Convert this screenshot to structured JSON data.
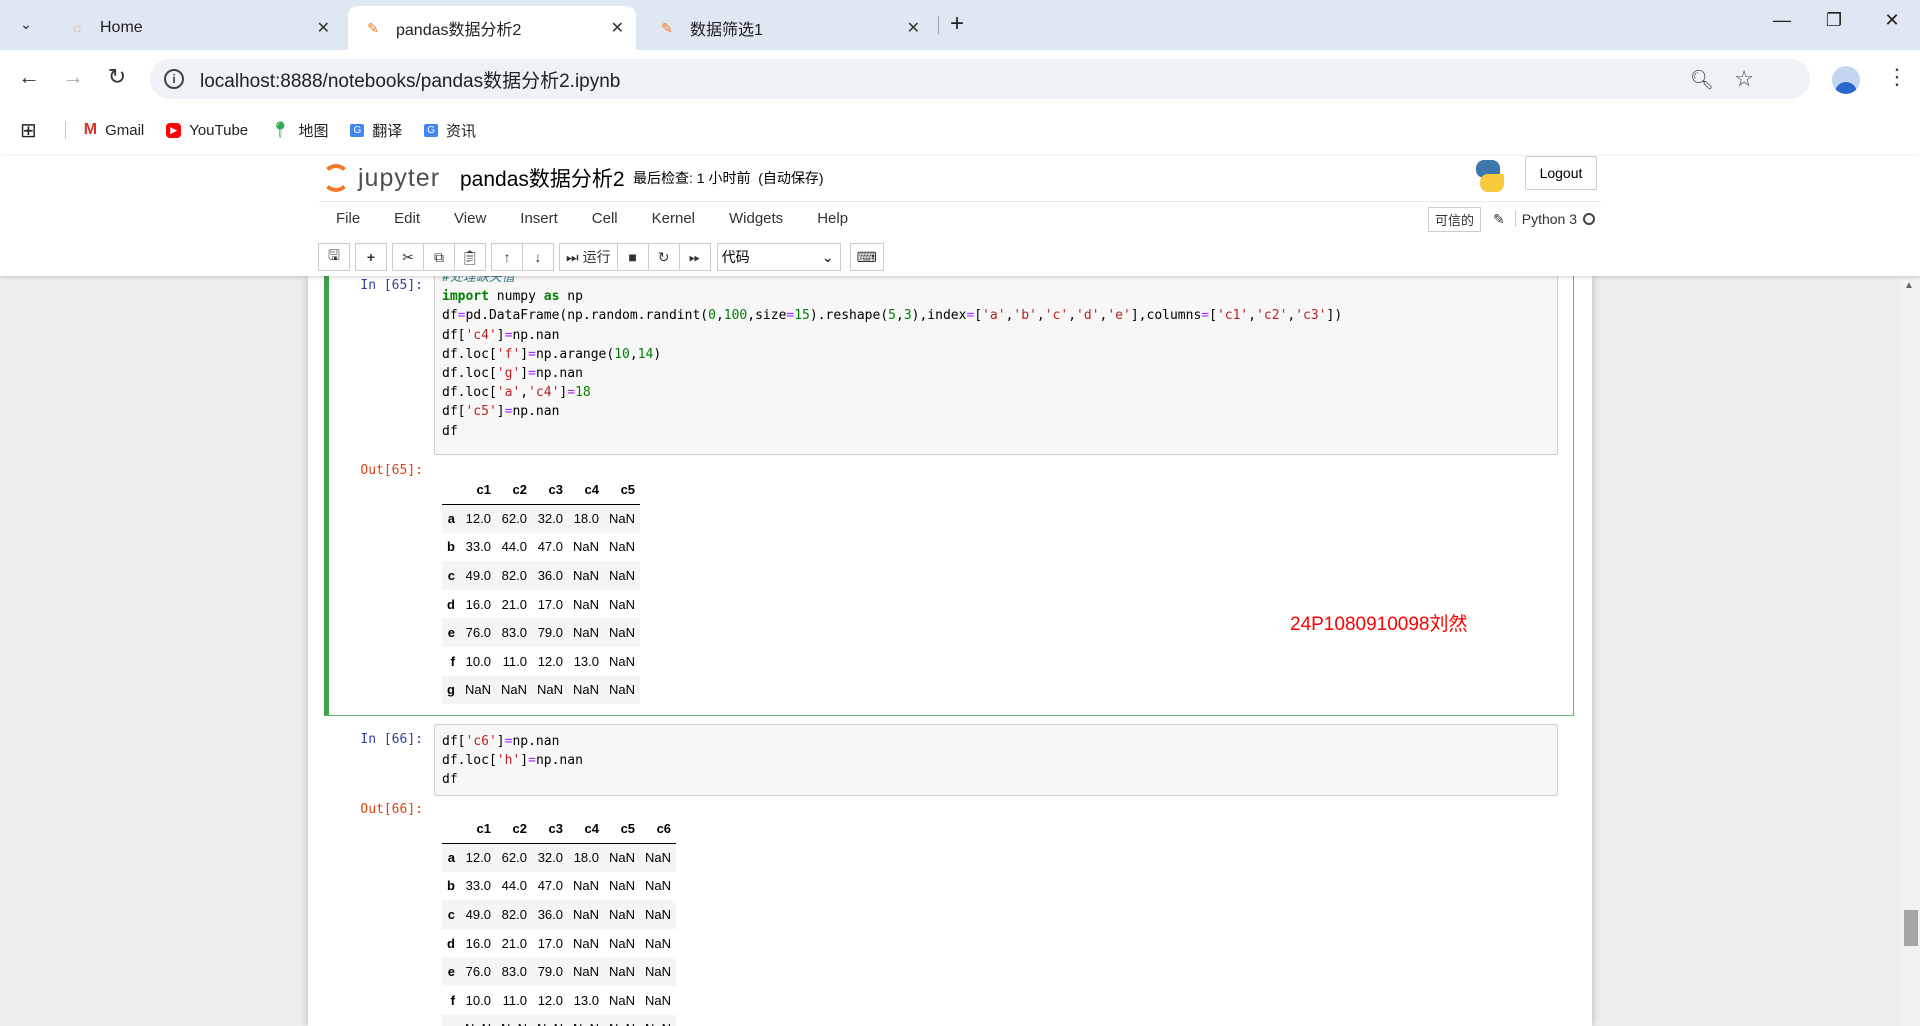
{
  "browser": {
    "tabs": [
      {
        "title": "Home",
        "active": false
      },
      {
        "title": "pandas数据分析2",
        "active": true
      },
      {
        "title": "数据筛选1",
        "active": false
      }
    ],
    "url": "localhost:8888/notebooks/pandas数据分析2.ipynb",
    "bookmarks": [
      "Gmail",
      "YouTube",
      "地图",
      "翻译",
      "资讯"
    ]
  },
  "jupyter": {
    "logo_text": "jupyter",
    "notebook_name": "pandas数据分析2",
    "checkpoint_label": "最后检查: 1 小时前",
    "autosave": "(自动保存)",
    "logout_label": "Logout",
    "menu": [
      "File",
      "Edit",
      "View",
      "Insert",
      "Cell",
      "Kernel",
      "Widgets",
      "Help"
    ],
    "trusted_label": "可信的",
    "kernel_name": "Python 3",
    "run_label": "运行",
    "cell_type": "代码"
  },
  "cells": [
    {
      "in_prompt": "In  [65]:",
      "out_prompt": "Out[65]:",
      "code": [
        "#处理缺失值",
        "import numpy as np",
        "df=pd.DataFrame(np.random.randint(0,100,size=15).reshape(5,3),index=['a','b','c','d','e'],columns=['c1','c2','c3'])",
        "df['c4']=np.nan",
        "df.loc['f']=np.arange(10,14)",
        "df.loc['g']=np.nan",
        "df.loc['a','c4']=18",
        "df['c5']=np.nan",
        "df"
      ],
      "table": {
        "columns": [
          "c1",
          "c2",
          "c3",
          "c4",
          "c5"
        ],
        "rows": [
          {
            "index": "a",
            "values": [
              "12.0",
              "62.0",
              "32.0",
              "18.0",
              "NaN"
            ]
          },
          {
            "index": "b",
            "values": [
              "33.0",
              "44.0",
              "47.0",
              "NaN",
              "NaN"
            ]
          },
          {
            "index": "c",
            "values": [
              "49.0",
              "82.0",
              "36.0",
              "NaN",
              "NaN"
            ]
          },
          {
            "index": "d",
            "values": [
              "16.0",
              "21.0",
              "17.0",
              "NaN",
              "NaN"
            ]
          },
          {
            "index": "e",
            "values": [
              "76.0",
              "83.0",
              "79.0",
              "NaN",
              "NaN"
            ]
          },
          {
            "index": "f",
            "values": [
              "10.0",
              "11.0",
              "12.0",
              "13.0",
              "NaN"
            ]
          },
          {
            "index": "g",
            "values": [
              "NaN",
              "NaN",
              "NaN",
              "NaN",
              "NaN"
            ]
          }
        ]
      }
    },
    {
      "in_prompt": "In  [66]:",
      "out_prompt": "Out[66]:",
      "code": [
        "df['c6']=np.nan",
        "df.loc['h']=np.nan",
        "df"
      ],
      "table": {
        "columns": [
          "c1",
          "c2",
          "c3",
          "c4",
          "c5",
          "c6"
        ],
        "rows": [
          {
            "index": "a",
            "values": [
              "12.0",
              "62.0",
              "32.0",
              "18.0",
              "NaN",
              "NaN"
            ]
          },
          {
            "index": "b",
            "values": [
              "33.0",
              "44.0",
              "47.0",
              "NaN",
              "NaN",
              "NaN"
            ]
          },
          {
            "index": "c",
            "values": [
              "49.0",
              "82.0",
              "36.0",
              "NaN",
              "NaN",
              "NaN"
            ]
          },
          {
            "index": "d",
            "values": [
              "16.0",
              "21.0",
              "17.0",
              "NaN",
              "NaN",
              "NaN"
            ]
          },
          {
            "index": "e",
            "values": [
              "76.0",
              "83.0",
              "79.0",
              "NaN",
              "NaN",
              "NaN"
            ]
          },
          {
            "index": "f",
            "values": [
              "10.0",
              "11.0",
              "12.0",
              "13.0",
              "NaN",
              "NaN"
            ]
          },
          {
            "index": "g",
            "values": [
              "NaN",
              "NaN",
              "NaN",
              "NaN",
              "NaN",
              "NaN"
            ]
          }
        ]
      }
    }
  ],
  "watermark": "24P1080910098刘然"
}
